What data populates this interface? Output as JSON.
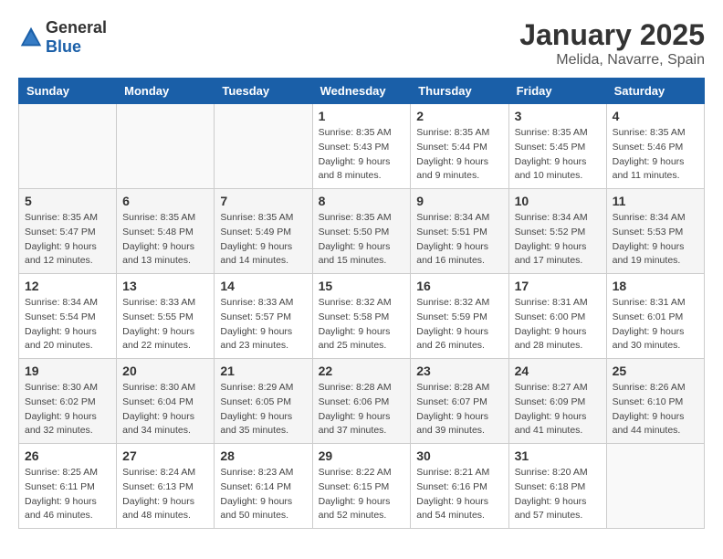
{
  "header": {
    "logo_general": "General",
    "logo_blue": "Blue",
    "month": "January 2025",
    "location": "Melida, Navarre, Spain"
  },
  "weekdays": [
    "Sunday",
    "Monday",
    "Tuesday",
    "Wednesday",
    "Thursday",
    "Friday",
    "Saturday"
  ],
  "weeks": [
    {
      "shaded": false,
      "days": [
        {
          "num": "",
          "sunrise": "",
          "sunset": "",
          "daylight": ""
        },
        {
          "num": "",
          "sunrise": "",
          "sunset": "",
          "daylight": ""
        },
        {
          "num": "",
          "sunrise": "",
          "sunset": "",
          "daylight": ""
        },
        {
          "num": "1",
          "sunrise": "Sunrise: 8:35 AM",
          "sunset": "Sunset: 5:43 PM",
          "daylight": "Daylight: 9 hours and 8 minutes."
        },
        {
          "num": "2",
          "sunrise": "Sunrise: 8:35 AM",
          "sunset": "Sunset: 5:44 PM",
          "daylight": "Daylight: 9 hours and 9 minutes."
        },
        {
          "num": "3",
          "sunrise": "Sunrise: 8:35 AM",
          "sunset": "Sunset: 5:45 PM",
          "daylight": "Daylight: 9 hours and 10 minutes."
        },
        {
          "num": "4",
          "sunrise": "Sunrise: 8:35 AM",
          "sunset": "Sunset: 5:46 PM",
          "daylight": "Daylight: 9 hours and 11 minutes."
        }
      ]
    },
    {
      "shaded": true,
      "days": [
        {
          "num": "5",
          "sunrise": "Sunrise: 8:35 AM",
          "sunset": "Sunset: 5:47 PM",
          "daylight": "Daylight: 9 hours and 12 minutes."
        },
        {
          "num": "6",
          "sunrise": "Sunrise: 8:35 AM",
          "sunset": "Sunset: 5:48 PM",
          "daylight": "Daylight: 9 hours and 13 minutes."
        },
        {
          "num": "7",
          "sunrise": "Sunrise: 8:35 AM",
          "sunset": "Sunset: 5:49 PM",
          "daylight": "Daylight: 9 hours and 14 minutes."
        },
        {
          "num": "8",
          "sunrise": "Sunrise: 8:35 AM",
          "sunset": "Sunset: 5:50 PM",
          "daylight": "Daylight: 9 hours and 15 minutes."
        },
        {
          "num": "9",
          "sunrise": "Sunrise: 8:34 AM",
          "sunset": "Sunset: 5:51 PM",
          "daylight": "Daylight: 9 hours and 16 minutes."
        },
        {
          "num": "10",
          "sunrise": "Sunrise: 8:34 AM",
          "sunset": "Sunset: 5:52 PM",
          "daylight": "Daylight: 9 hours and 17 minutes."
        },
        {
          "num": "11",
          "sunrise": "Sunrise: 8:34 AM",
          "sunset": "Sunset: 5:53 PM",
          "daylight": "Daylight: 9 hours and 19 minutes."
        }
      ]
    },
    {
      "shaded": false,
      "days": [
        {
          "num": "12",
          "sunrise": "Sunrise: 8:34 AM",
          "sunset": "Sunset: 5:54 PM",
          "daylight": "Daylight: 9 hours and 20 minutes."
        },
        {
          "num": "13",
          "sunrise": "Sunrise: 8:33 AM",
          "sunset": "Sunset: 5:55 PM",
          "daylight": "Daylight: 9 hours and 22 minutes."
        },
        {
          "num": "14",
          "sunrise": "Sunrise: 8:33 AM",
          "sunset": "Sunset: 5:57 PM",
          "daylight": "Daylight: 9 hours and 23 minutes."
        },
        {
          "num": "15",
          "sunrise": "Sunrise: 8:32 AM",
          "sunset": "Sunset: 5:58 PM",
          "daylight": "Daylight: 9 hours and 25 minutes."
        },
        {
          "num": "16",
          "sunrise": "Sunrise: 8:32 AM",
          "sunset": "Sunset: 5:59 PM",
          "daylight": "Daylight: 9 hours and 26 minutes."
        },
        {
          "num": "17",
          "sunrise": "Sunrise: 8:31 AM",
          "sunset": "Sunset: 6:00 PM",
          "daylight": "Daylight: 9 hours and 28 minutes."
        },
        {
          "num": "18",
          "sunrise": "Sunrise: 8:31 AM",
          "sunset": "Sunset: 6:01 PM",
          "daylight": "Daylight: 9 hours and 30 minutes."
        }
      ]
    },
    {
      "shaded": true,
      "days": [
        {
          "num": "19",
          "sunrise": "Sunrise: 8:30 AM",
          "sunset": "Sunset: 6:02 PM",
          "daylight": "Daylight: 9 hours and 32 minutes."
        },
        {
          "num": "20",
          "sunrise": "Sunrise: 8:30 AM",
          "sunset": "Sunset: 6:04 PM",
          "daylight": "Daylight: 9 hours and 34 minutes."
        },
        {
          "num": "21",
          "sunrise": "Sunrise: 8:29 AM",
          "sunset": "Sunset: 6:05 PM",
          "daylight": "Daylight: 9 hours and 35 minutes."
        },
        {
          "num": "22",
          "sunrise": "Sunrise: 8:28 AM",
          "sunset": "Sunset: 6:06 PM",
          "daylight": "Daylight: 9 hours and 37 minutes."
        },
        {
          "num": "23",
          "sunrise": "Sunrise: 8:28 AM",
          "sunset": "Sunset: 6:07 PM",
          "daylight": "Daylight: 9 hours and 39 minutes."
        },
        {
          "num": "24",
          "sunrise": "Sunrise: 8:27 AM",
          "sunset": "Sunset: 6:09 PM",
          "daylight": "Daylight: 9 hours and 41 minutes."
        },
        {
          "num": "25",
          "sunrise": "Sunrise: 8:26 AM",
          "sunset": "Sunset: 6:10 PM",
          "daylight": "Daylight: 9 hours and 44 minutes."
        }
      ]
    },
    {
      "shaded": false,
      "days": [
        {
          "num": "26",
          "sunrise": "Sunrise: 8:25 AM",
          "sunset": "Sunset: 6:11 PM",
          "daylight": "Daylight: 9 hours and 46 minutes."
        },
        {
          "num": "27",
          "sunrise": "Sunrise: 8:24 AM",
          "sunset": "Sunset: 6:13 PM",
          "daylight": "Daylight: 9 hours and 48 minutes."
        },
        {
          "num": "28",
          "sunrise": "Sunrise: 8:23 AM",
          "sunset": "Sunset: 6:14 PM",
          "daylight": "Daylight: 9 hours and 50 minutes."
        },
        {
          "num": "29",
          "sunrise": "Sunrise: 8:22 AM",
          "sunset": "Sunset: 6:15 PM",
          "daylight": "Daylight: 9 hours and 52 minutes."
        },
        {
          "num": "30",
          "sunrise": "Sunrise: 8:21 AM",
          "sunset": "Sunset: 6:16 PM",
          "daylight": "Daylight: 9 hours and 54 minutes."
        },
        {
          "num": "31",
          "sunrise": "Sunrise: 8:20 AM",
          "sunset": "Sunset: 6:18 PM",
          "daylight": "Daylight: 9 hours and 57 minutes."
        },
        {
          "num": "",
          "sunrise": "",
          "sunset": "",
          "daylight": ""
        }
      ]
    }
  ]
}
